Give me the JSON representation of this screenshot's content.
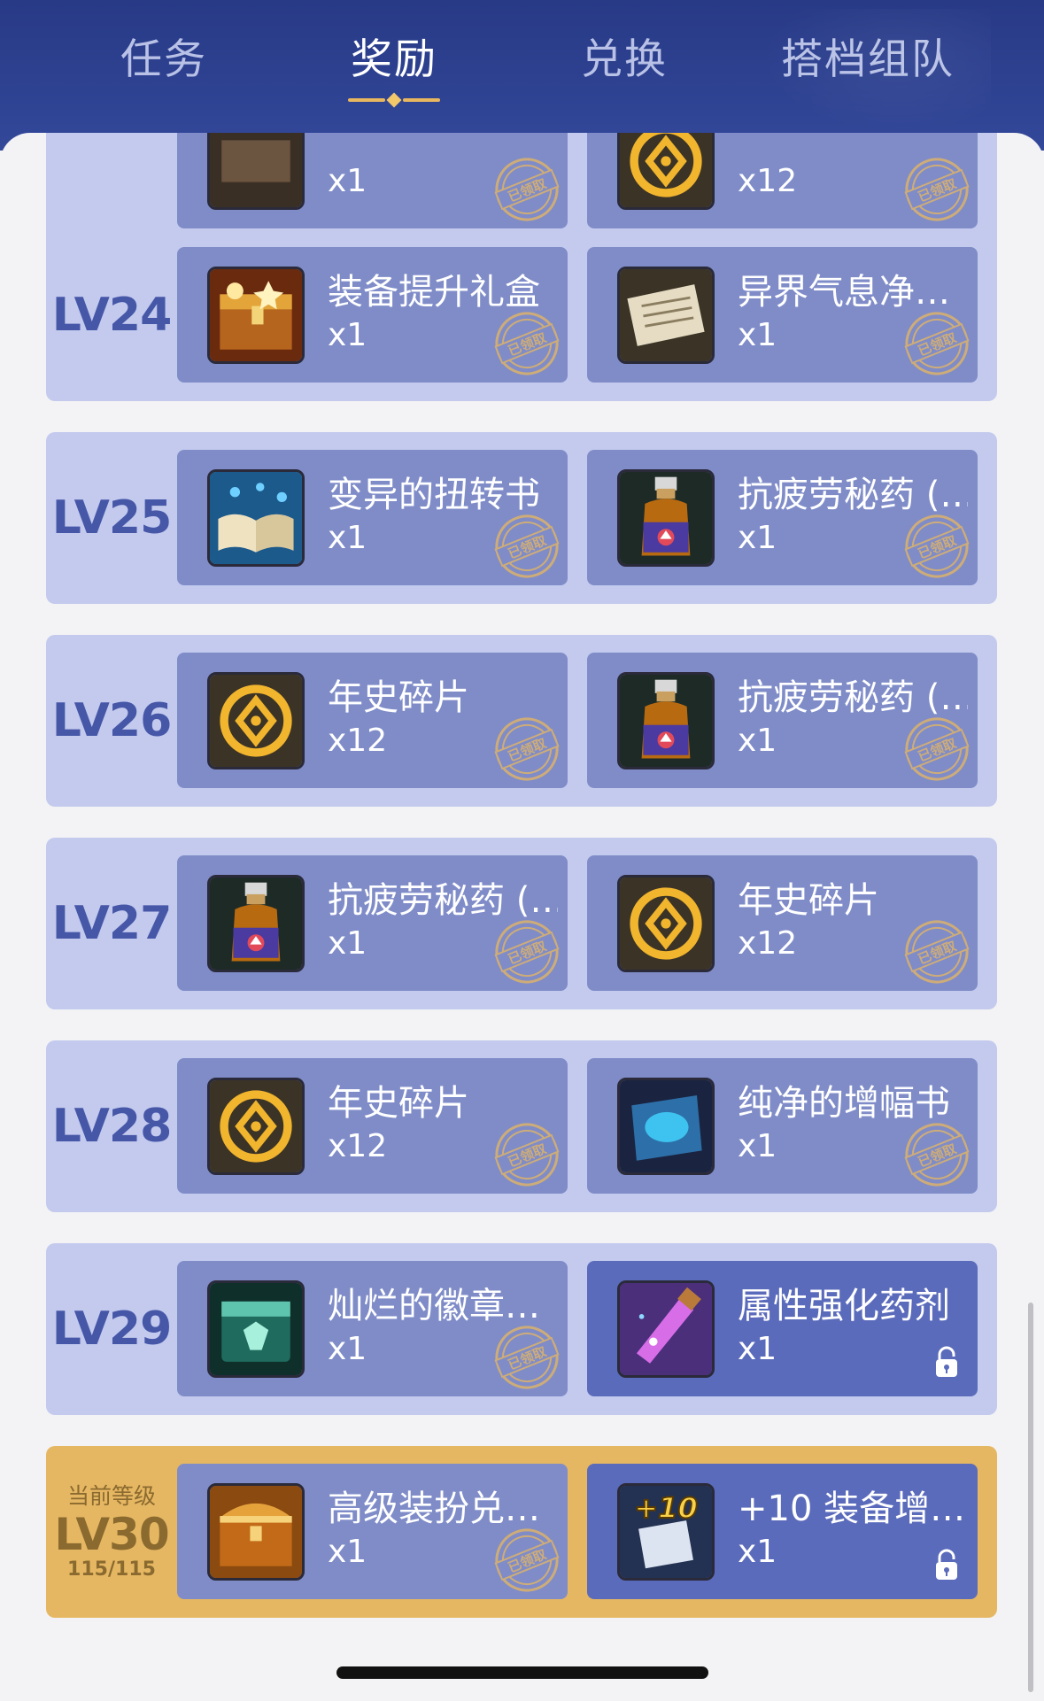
{
  "tabs": [
    {
      "label": "任务",
      "active": false
    },
    {
      "label": "奖励",
      "active": true
    },
    {
      "label": "兑换",
      "active": false
    },
    {
      "label": "搭档组队",
      "active": false
    }
  ],
  "claimed_stamp_text": "已领取",
  "levels": [
    {
      "level": "",
      "left": {
        "name": "",
        "qty": "x1",
        "icon": "leather-item-icon",
        "status": "claimed"
      },
      "right": {
        "name": "",
        "qty": "x12",
        "icon": "chronicle-fragment-icon",
        "status": "claimed"
      }
    },
    {
      "level": "LV24",
      "left": {
        "name": "装备提升礼盒",
        "qty": "x1",
        "icon": "treasure-chest-icon",
        "status": "claimed"
      },
      "right": {
        "name": "异界气息净…",
        "qty": "x1",
        "icon": "scroll-icon",
        "status": "claimed"
      }
    },
    {
      "level": "LV25",
      "left": {
        "name": "变异的扭转书",
        "qty": "x1",
        "icon": "open-book-icon",
        "status": "claimed"
      },
      "right": {
        "name": "抗疲劳秘药 (…",
        "qty": "x1",
        "icon": "potion-bottle-icon",
        "status": "claimed"
      }
    },
    {
      "level": "LV26",
      "left": {
        "name": "年史碎片",
        "qty": "x12",
        "icon": "chronicle-fragment-icon",
        "status": "claimed"
      },
      "right": {
        "name": "抗疲劳秘药 (…",
        "qty": "x1",
        "icon": "potion-bottle-icon",
        "status": "claimed"
      }
    },
    {
      "level": "LV27",
      "left": {
        "name": "抗疲劳秘药 (…",
        "qty": "x1",
        "icon": "potion-bottle-icon",
        "status": "claimed"
      },
      "right": {
        "name": "年史碎片",
        "qty": "x12",
        "icon": "chronicle-fragment-icon",
        "status": "claimed"
      }
    },
    {
      "level": "LV28",
      "left": {
        "name": "年史碎片",
        "qty": "x12",
        "icon": "chronicle-fragment-icon",
        "status": "claimed"
      },
      "right": {
        "name": "纯净的增幅书",
        "qty": "x1",
        "icon": "blue-book-icon",
        "status": "claimed"
      }
    },
    {
      "level": "LV29",
      "left": {
        "name": "灿烂的徽章…",
        "qty": "x1",
        "icon": "emblem-box-icon",
        "status": "claimed"
      },
      "right": {
        "name": "属性强化药剂",
        "qty": "x1",
        "icon": "vial-icon",
        "status": "locked"
      }
    },
    {
      "level": "LV30",
      "current": true,
      "caption": "当前等级",
      "progress": "115/115",
      "left": {
        "name": "高级装扮兑…",
        "qty": "x1",
        "icon": "golden-chest-icon",
        "status": "claimed"
      },
      "right": {
        "name": "+10 装备增…",
        "qty": "x1",
        "icon": "plus10-upgrade-icon",
        "status": "locked"
      }
    }
  ],
  "icon_text": {
    "plus10": "+10"
  },
  "colors": {
    "header": "#2e4292",
    "row": "#c3caee",
    "row_current": "#e6b763",
    "card": "#7f8cc8",
    "card_locked": "#5b6bbb",
    "level_text": "#4657a8",
    "stamp": "#e8b75e"
  }
}
